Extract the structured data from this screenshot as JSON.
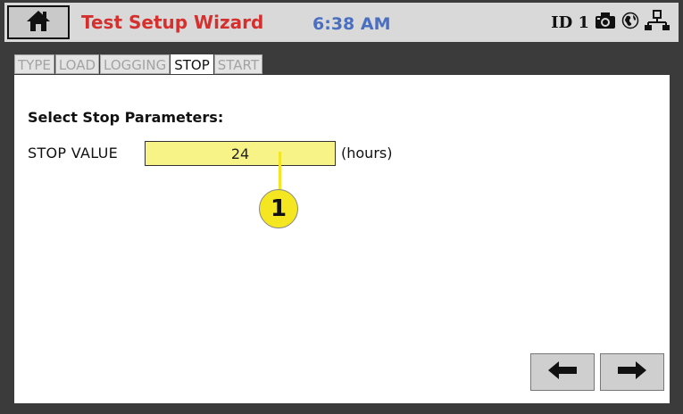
{
  "header": {
    "title": "Test Setup Wizard",
    "time": "6:38 AM",
    "id_label": "ID 1",
    "icons": [
      "home-icon",
      "camera-icon",
      "globe-icon",
      "network-icon"
    ],
    "title_color": "#d5302e",
    "time_color": "#4b6fc0"
  },
  "tabs": [
    {
      "label": "TYPE",
      "active": false
    },
    {
      "label": "LOAD",
      "active": false
    },
    {
      "label": "LOGGING",
      "active": false
    },
    {
      "label": "STOP",
      "active": true
    },
    {
      "label": "START",
      "active": false
    }
  ],
  "main": {
    "section_title": "Select Stop Parameters:",
    "stop_value_label": "STOP VALUE",
    "stop_value": "24",
    "unit": "(hours)",
    "callout_number": "1",
    "input_color": "#f7f386",
    "callout_color": "#f5e622"
  },
  "nav": {
    "back_icon": "arrow-left-icon",
    "next_icon": "arrow-right-icon"
  }
}
